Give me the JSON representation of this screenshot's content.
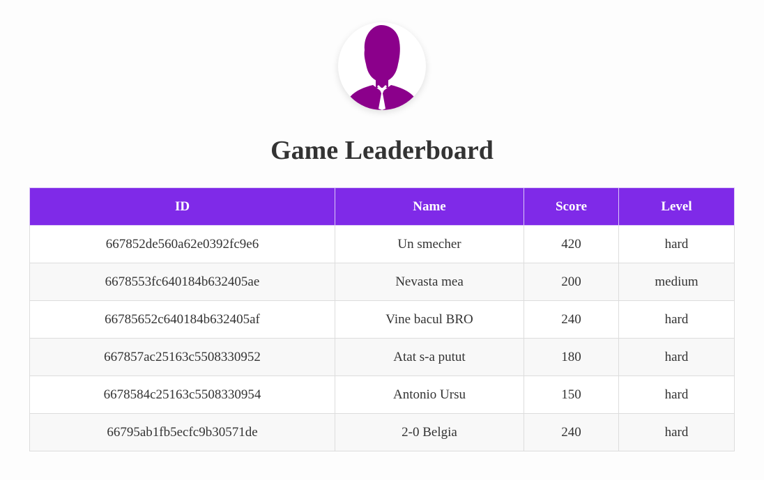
{
  "page": {
    "title": "Game Leaderboard",
    "avatar_icon": "user-silhouette-icon",
    "accent_color": "#8b008b"
  },
  "table": {
    "header_color": "#7f2ae8",
    "columns": [
      "ID",
      "Name",
      "Score",
      "Level"
    ],
    "rows": [
      [
        "667852de560a62e0392fc9e6",
        "Un smecher",
        "420",
        "hard"
      ],
      [
        "6678553fc640184b632405ae",
        "Nevasta mea",
        "200",
        "medium"
      ],
      [
        "66785652c640184b632405af",
        "Vine bacul BRO",
        "240",
        "hard"
      ],
      [
        "667857ac25163c5508330952",
        "Atat s-a putut",
        "180",
        "hard"
      ],
      [
        "6678584c25163c5508330954",
        "Antonio Ursu",
        "150",
        "hard"
      ],
      [
        "66795ab1fb5ecfc9b30571de",
        "2-0 Belgia",
        "240",
        "hard"
      ]
    ]
  }
}
